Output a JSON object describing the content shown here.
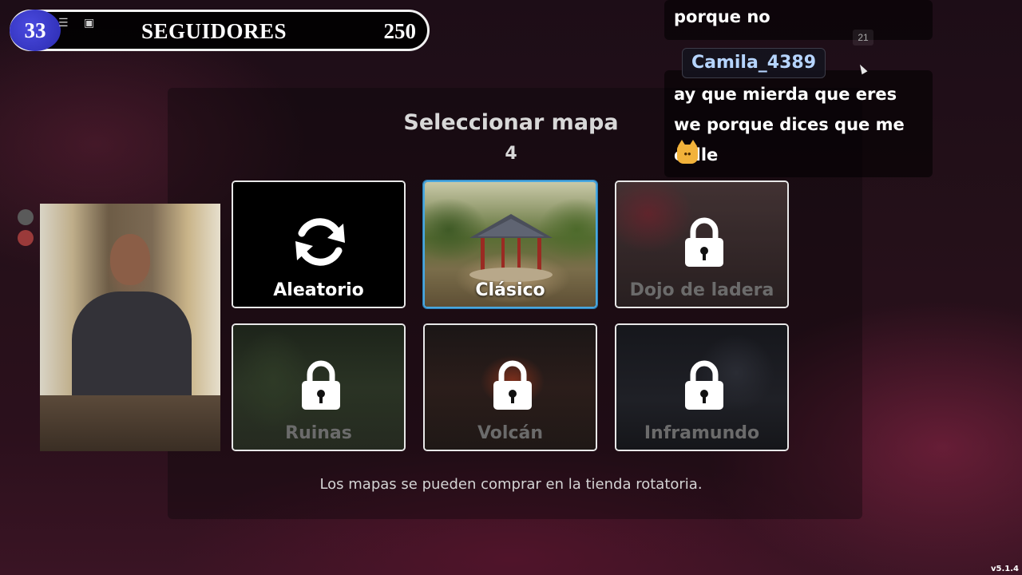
{
  "follower_bar": {
    "count": "33",
    "label": "SEGUIDORES",
    "goal": "250",
    "menu_icon": "menu-icon",
    "chat_icon": "chat-icon"
  },
  "chat": {
    "previous_message": "porque no",
    "timestamp": "21",
    "username": "Camila_4389",
    "message": "ay que mierda que eres we porque dices que me calle",
    "emoji": "cat-emoji"
  },
  "map_select": {
    "title": "Seleccionar mapa",
    "count": "4",
    "maps": [
      {
        "name": "Aleatorio",
        "state": "random"
      },
      {
        "name": "Clásico",
        "state": "selected"
      },
      {
        "name": "Dojo de ladera",
        "state": "locked"
      },
      {
        "name": "Ruinas",
        "state": "locked"
      },
      {
        "name": "Volcán",
        "state": "locked"
      },
      {
        "name": "Inframundo",
        "state": "locked"
      }
    ],
    "hint": "Los mapas se pueden comprar en la tienda rotatoria."
  },
  "version": "v5.1.4",
  "colors": {
    "selected_border": "#4aa8e0",
    "follower_circle": "#3b3bc8",
    "username_text": "#b6d5ff"
  }
}
